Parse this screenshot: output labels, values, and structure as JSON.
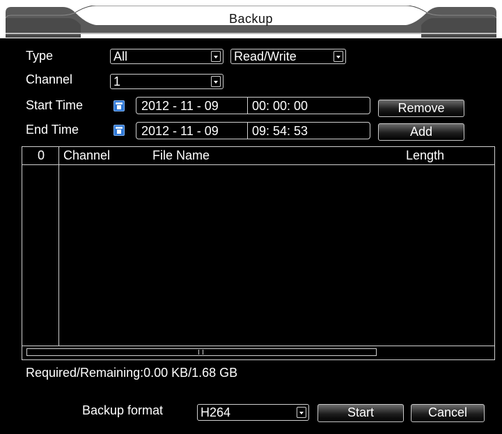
{
  "window": {
    "title": "Backup"
  },
  "form": {
    "type_label": "Type",
    "type_value": "All",
    "mode_value": "Read/Write",
    "channel_label": "Channel",
    "channel_value": "1",
    "start_label": "Start Time",
    "start_date": "2012 - 11 - 09",
    "start_time": "00: 00: 00",
    "end_label": "End Time",
    "end_date": "2012 - 11 - 09",
    "end_time": "09: 54: 53",
    "remove_label": "Remove",
    "add_label": "Add"
  },
  "table": {
    "columns": [
      "0",
      "Channel",
      "File Name",
      "Length"
    ],
    "rows": []
  },
  "status": {
    "required_remaining": "Required/Remaining:0.00 KB/1.68 GB"
  },
  "footer": {
    "format_label": "Backup format",
    "format_value": "H264",
    "start_label": "Start",
    "cancel_label": "Cancel"
  },
  "icons": [
    "calendar-icon",
    "chevron-down-icon"
  ],
  "colors": {
    "background": "#000000",
    "frame": "#d0d0d0",
    "titlebar": "#ffffff",
    "calendar": "#2f78d6"
  }
}
